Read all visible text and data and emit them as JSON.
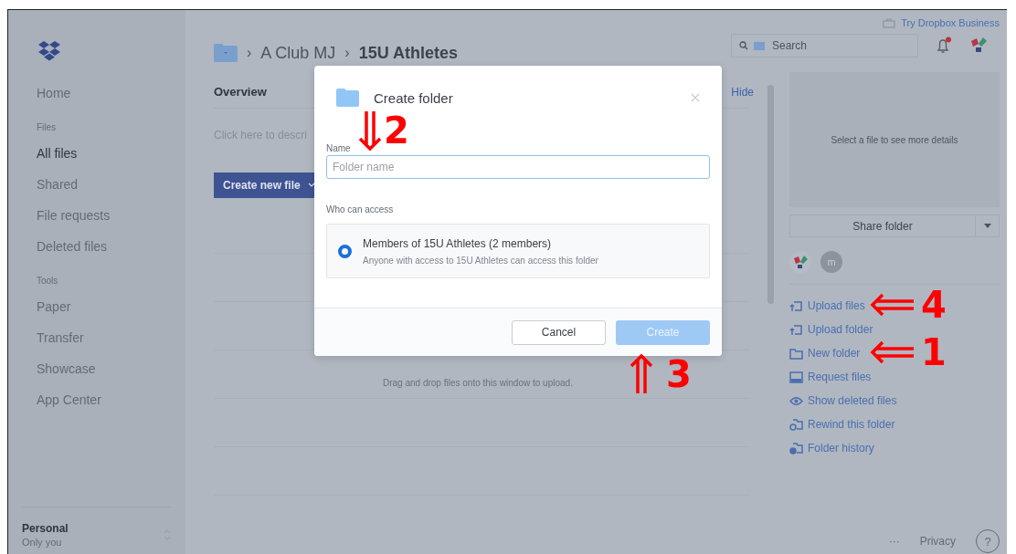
{
  "top_link": {
    "label": "Try Dropbox Business"
  },
  "sidebar": {
    "items": [
      {
        "kind": "item",
        "label": "Home",
        "selected": false
      },
      {
        "kind": "section",
        "label": "Files"
      },
      {
        "kind": "item",
        "label": "All files",
        "selected": true
      },
      {
        "kind": "item",
        "label": "Shared",
        "selected": false
      },
      {
        "kind": "item",
        "label": "File requests",
        "selected": false
      },
      {
        "kind": "item",
        "label": "Deleted files",
        "selected": false
      },
      {
        "kind": "section",
        "label": "Tools"
      },
      {
        "kind": "item",
        "label": "Paper",
        "selected": false
      },
      {
        "kind": "item",
        "label": "Transfer",
        "selected": false
      },
      {
        "kind": "item",
        "label": "Showcase",
        "selected": false
      },
      {
        "kind": "item",
        "label": "App Center",
        "selected": false
      }
    ],
    "account": {
      "name": "Personal",
      "detail": "Only you"
    }
  },
  "breadcrumb": {
    "separator": "›",
    "parent": "A Club MJ",
    "current": "15U Athletes"
  },
  "overview": {
    "title": "Overview",
    "hide": "Hide",
    "description": "Click here to descri",
    "create_button": "Create new file",
    "drop_hint": "Drag and drop files onto this window to upload."
  },
  "search": {
    "placeholder": "Search"
  },
  "notifications": {
    "unread": true
  },
  "details": {
    "empty_text": "Select a file to see more details",
    "share_button": "Share folder",
    "members": [
      {
        "kind": "logo"
      },
      {
        "kind": "initial",
        "label": "m"
      }
    ]
  },
  "actions": [
    {
      "kind": "upload-files",
      "label": "Upload files",
      "annotation": {
        "label": "4",
        "kind": "left"
      }
    },
    {
      "kind": "upload-folder",
      "label": "Upload folder"
    },
    {
      "kind": "new-folder",
      "label": "New folder",
      "annotation": {
        "label": "1",
        "kind": "left"
      }
    },
    {
      "kind": "request",
      "label": "Request files"
    },
    {
      "kind": "deleted",
      "label": "Show deleted files"
    },
    {
      "kind": "rewind",
      "label": "Rewind this folder"
    },
    {
      "kind": "history",
      "label": "Folder history"
    }
  ],
  "footer": {
    "more": "···",
    "privacy": "Privacy",
    "help": "?"
  },
  "dialog": {
    "title": "Create folder",
    "name_label": "Name",
    "name_annotation": {
      "label": "2",
      "kind": "down"
    },
    "name_placeholder": "Folder name",
    "access_label": "Who can access",
    "options": [
      {
        "title": "Members of 15U Athletes (2 members)",
        "detail": "Anyone with access to 15U Athletes can access this folder",
        "selected": true
      }
    ],
    "buttons": [
      {
        "kind": "secondary",
        "label": "Cancel",
        "disabled": false
      },
      {
        "kind": "primary",
        "label": "Create",
        "disabled": true,
        "annotation": {
          "label": "3",
          "kind": "up"
        }
      }
    ]
  }
}
